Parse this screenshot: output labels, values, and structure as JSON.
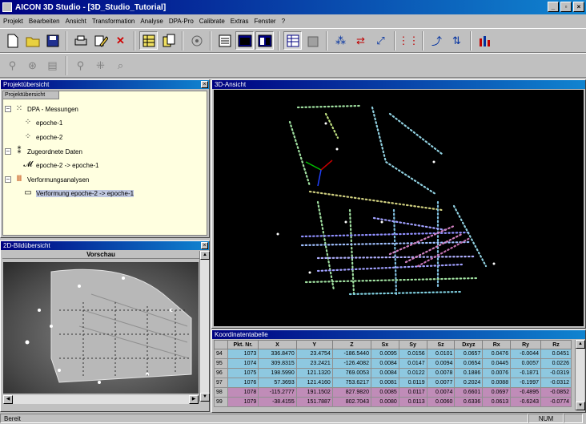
{
  "window": {
    "title": "AICON 3D Studio  - [3D_Studio_Tutorial]"
  },
  "menu": [
    "Projekt",
    "Bearbeiten",
    "Ansicht",
    "Transformation",
    "Analyse",
    "DPA-Pro",
    "Calibrate",
    "Extras",
    "Fenster",
    "?"
  ],
  "toolbar1": [
    "new-file",
    "open-folder",
    "save",
    "print",
    "edit-pencil",
    "delete-x",
    "grid-table",
    "copy-sheets",
    "settings-dial",
    "panel-a",
    "panel-b",
    "panel-c",
    "panel-d",
    "panel-e",
    "transform-a",
    "transform-b",
    "transform-c",
    "transform-d",
    "transform-e",
    "transform-f",
    "chart-bars"
  ],
  "toolbar2": [
    "measure-a",
    "target-points",
    "report",
    "tool-b",
    "tool-c",
    "tool-d"
  ],
  "project_panel": {
    "title": "Projektübersicht",
    "header": "Projektübersicht",
    "nodes": [
      {
        "label": "DPA - Messungen",
        "icon": "measurement-group-icon"
      },
      {
        "label": "epoche-1",
        "icon": "points-icon"
      },
      {
        "label": "epoche-2",
        "icon": "points-icon"
      },
      {
        "label": "Zugeordnete Daten",
        "icon": "assigned-data-icon"
      },
      {
        "label": "epoche-2 -> epoche-1",
        "icon": "link-icon"
      },
      {
        "label": "Verformungsanalysen",
        "icon": "deformation-icon"
      },
      {
        "label": "Verformung epoche-2 -> epoche-1",
        "icon": "deformation-item-icon"
      }
    ]
  },
  "image_panel": {
    "title": "2D-Bildübersicht",
    "subheader": "Vorschau"
  },
  "view3d": {
    "title": "3D-Ansicht"
  },
  "coord_table": {
    "title": "Koordinatentabelle",
    "columns": [
      "",
      "Pkt. Nr.",
      "X",
      "Y",
      "Z",
      "Sx",
      "Sy",
      "Sz",
      "Dxyz",
      "Rx",
      "Ry",
      "Rz"
    ],
    "rows": [
      {
        "cells": [
          "94",
          "1073",
          "336.8470",
          "23.4754",
          "-186.5440",
          "0.0095",
          "0.0156",
          "0.0101",
          "0.0657",
          "0.0476",
          "-0.0044",
          "0.0451"
        ],
        "color": "#8ec8e0"
      },
      {
        "cells": [
          "95",
          "1074",
          "309.8315",
          "23.2421",
          "-126.4082",
          "0.0084",
          "0.0147",
          "0.0094",
          "0.0654",
          "0.0445",
          "0.0057",
          "0.0226"
        ],
        "color": "#8ec8e0"
      },
      {
        "cells": [
          "96",
          "1075",
          "198.5990",
          "121.1320",
          "769.0053",
          "0.0084",
          "0.0122",
          "0.0078",
          "0.1886",
          "0.0076",
          "-0.1871",
          "-0.0319"
        ],
        "color": "#8ec8e0"
      },
      {
        "cells": [
          "97",
          "1076",
          "57.3693",
          "121.4160",
          "753.6217",
          "0.0081",
          "0.0119",
          "0.0077",
          "0.2024",
          "0.0088",
          "-0.1997",
          "-0.0312"
        ],
        "color": "#8ec8e0"
      },
      {
        "cells": [
          "98",
          "1078",
          "-115.2777",
          "191.1502",
          "827.9820",
          "0.0085",
          "0.0117",
          "0.0074",
          "0.6601",
          "0.0697",
          "-0.4895",
          "-0.0852"
        ],
        "color": "#c08cb8"
      },
      {
        "cells": [
          "99",
          "1079",
          "-38.4155",
          "151.7887",
          "802.7043",
          "0.0080",
          "0.0113",
          "0.0060",
          "0.6336",
          "0.0613",
          "-0.6243",
          "-0.0774"
        ],
        "color": "#c08cb8"
      }
    ]
  },
  "status": {
    "left": "Bereit",
    "num": "NUM"
  },
  "colors": {
    "title_start": "#000080",
    "title_end": "#1084d0",
    "tree_bg": "#ffffe0",
    "view_bg": "#000000"
  }
}
